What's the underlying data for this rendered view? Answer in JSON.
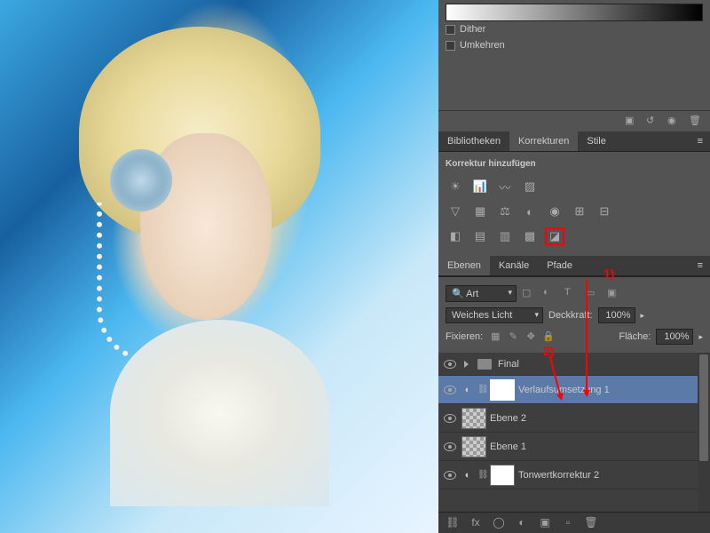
{
  "gradient": {
    "dither_label": "Dither",
    "reverse_label": "Umkehren"
  },
  "tabs_corrections": {
    "tab1": "Bibliotheken",
    "tab2": "Korrekturen",
    "tab3": "Stile"
  },
  "corrections": {
    "heading": "Korrektur hinzufügen"
  },
  "tabs_layers": {
    "tab1": "Ebenen",
    "tab2": "Kanäle",
    "tab3": "Pfade"
  },
  "layer_controls": {
    "filter_label": "Art",
    "blend_mode": "Weiches Licht",
    "opacity_label": "Deckkraft:",
    "opacity_value": "100%",
    "lock_label": "Fixieren:",
    "fill_label": "Fläche:",
    "fill_value": "100%"
  },
  "layers": [
    {
      "name": "Final",
      "type": "group"
    },
    {
      "name": "Verlaufsumsetzung 1",
      "type": "adjustment",
      "selected": true
    },
    {
      "name": "Ebene 2",
      "type": "normal"
    },
    {
      "name": "Ebene 1",
      "type": "normal"
    },
    {
      "name": "Tonwertkorrektur 2",
      "type": "adjustment"
    }
  ],
  "annotations": {
    "marker1": "1)",
    "marker2": "2)"
  }
}
